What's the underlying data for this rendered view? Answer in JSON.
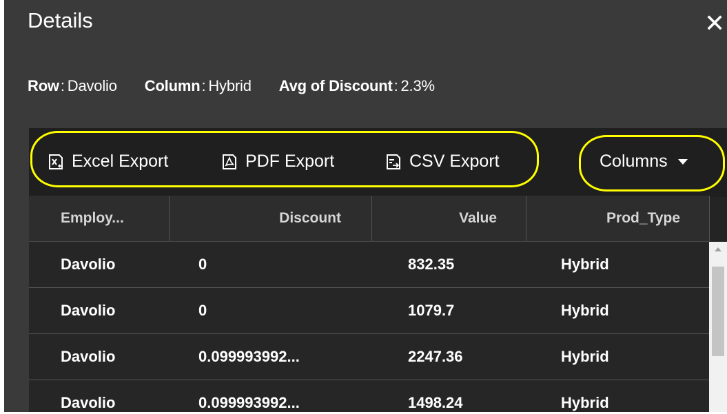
{
  "dialog": {
    "title": "Details",
    "close_glyph": "✕"
  },
  "summary": {
    "row_label": "Row",
    "row_value": "Davolio",
    "column_label": "Column",
    "column_value": "Hybrid",
    "measure_label": "Avg of Discount",
    "measure_value": "2.3%"
  },
  "toolbar": {
    "excel_export": "Excel Export",
    "pdf_export": "PDF Export",
    "csv_export": "CSV Export",
    "columns": "Columns"
  },
  "table": {
    "headers": [
      "Employ...",
      "Discount",
      "Value",
      "Prod_Type"
    ],
    "rows": [
      [
        "Davolio",
        "0",
        "832.35",
        "Hybrid"
      ],
      [
        "Davolio",
        "0",
        "1079.7",
        "Hybrid"
      ],
      [
        "Davolio",
        "0.099993992...",
        "2247.36",
        "Hybrid"
      ],
      [
        "Davolio",
        "0.099993992...",
        "1498.24",
        "Hybrid"
      ]
    ]
  },
  "colors": {
    "highlight": "#ffff00",
    "dialog_bg": "#3a3a3a",
    "toolbar_bg": "#1f1f1f"
  }
}
